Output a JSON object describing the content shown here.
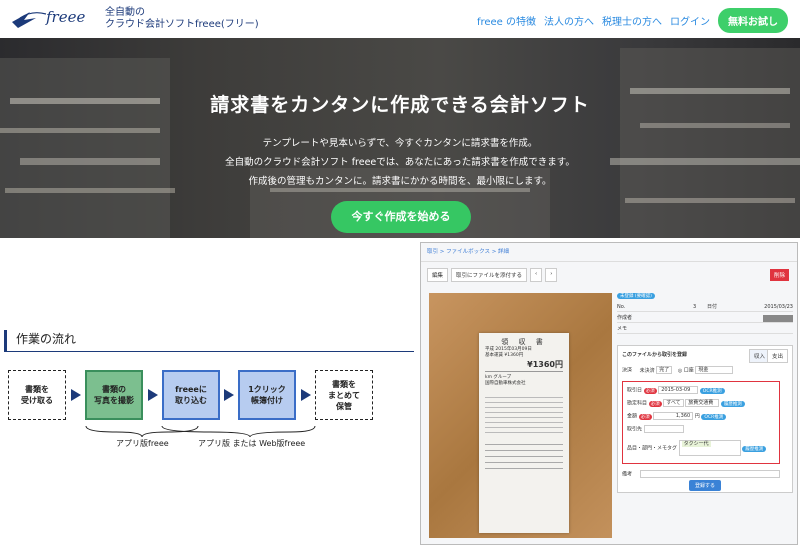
{
  "header": {
    "logo_text": "freee",
    "tagline_line1": "全自動の",
    "tagline_line2": "クラウド会計ソフトfreee(フリー)",
    "nav": [
      "freee の特徴",
      "法人の方へ",
      "税理士の方へ",
      "ログイン"
    ],
    "cta": "無料お試し"
  },
  "hero": {
    "title": "請求書をカンタンに作成できる会計ソフト",
    "lines": [
      "テンプレートや見本いらずで、今すぐカンタンに請求書を作成。",
      "全自動のクラウド会計ソフト freeeでは、あなたにあった請求書を作成できます。",
      "作成後の管理もカンタンに。請求書にかかる時間を、最小限にします。"
    ],
    "cta": "今すぐ作成を始める"
  },
  "workflow": {
    "title": "作業の流れ",
    "steps": [
      {
        "label": "書類を\n受け取る"
      },
      {
        "label": "書類の\n写真を撮影"
      },
      {
        "label": "freeeに\n取り込む"
      },
      {
        "label": "1クリック\n帳簿付け"
      },
      {
        "label": "書類を\nまとめて\n保管"
      }
    ],
    "brace1": "アプリ版freee",
    "brace2": "アプリ版 または Web版freee"
  },
  "app": {
    "breadcrumb": "取引 > ファイルボックス > 詳細",
    "toolbar": [
      "編集",
      "取引にファイルを添付する",
      "‹",
      "›"
    ],
    "delete": "削除",
    "status_pill": "未登録 (要確認)",
    "meta": {
      "no_label": "No.",
      "no_value": "3",
      "date_label": "日付",
      "date_value": "2015/03/23",
      "creator_label": "作成者",
      "memo_label": "メモ"
    },
    "panel_title": "このファイルから取引を登録",
    "income": "収入",
    "expense": "支出",
    "settle_label": "決済",
    "settle_options": [
      "未決済",
      "完了"
    ],
    "account_label": "口座",
    "account_value": "現金",
    "date_field_label": "取引日",
    "date_field_value": "2015-03-09",
    "ocr_badge": "OCR推測",
    "item_label": "勘定科目",
    "item_filter": "すべて",
    "item_value": "旅費交通費",
    "history_badge": "履歴推測",
    "amount_label": "金額",
    "amount_value": "1,360",
    "amount_unit": "円",
    "partner_label": "取引先",
    "tags_label": "品目・部門・メモタグ",
    "tag_value": "タクシー代",
    "required": "必須",
    "remark_label": "備考",
    "submit": "登録する"
  },
  "receipt": {
    "title": "領 収 書",
    "lines": [
      "平成 2015年03月09日",
      "基本運賃 ¥1360円"
    ],
    "amount": "¥1360円",
    "company": "km グループ",
    "company2": "国際自動車株式会社"
  },
  "colors": {
    "brand_green": "#3ecf6a",
    "brand_blue": "#1c3a7a",
    "link_blue": "#2a8ae0",
    "alert_red": "#e0343f"
  }
}
